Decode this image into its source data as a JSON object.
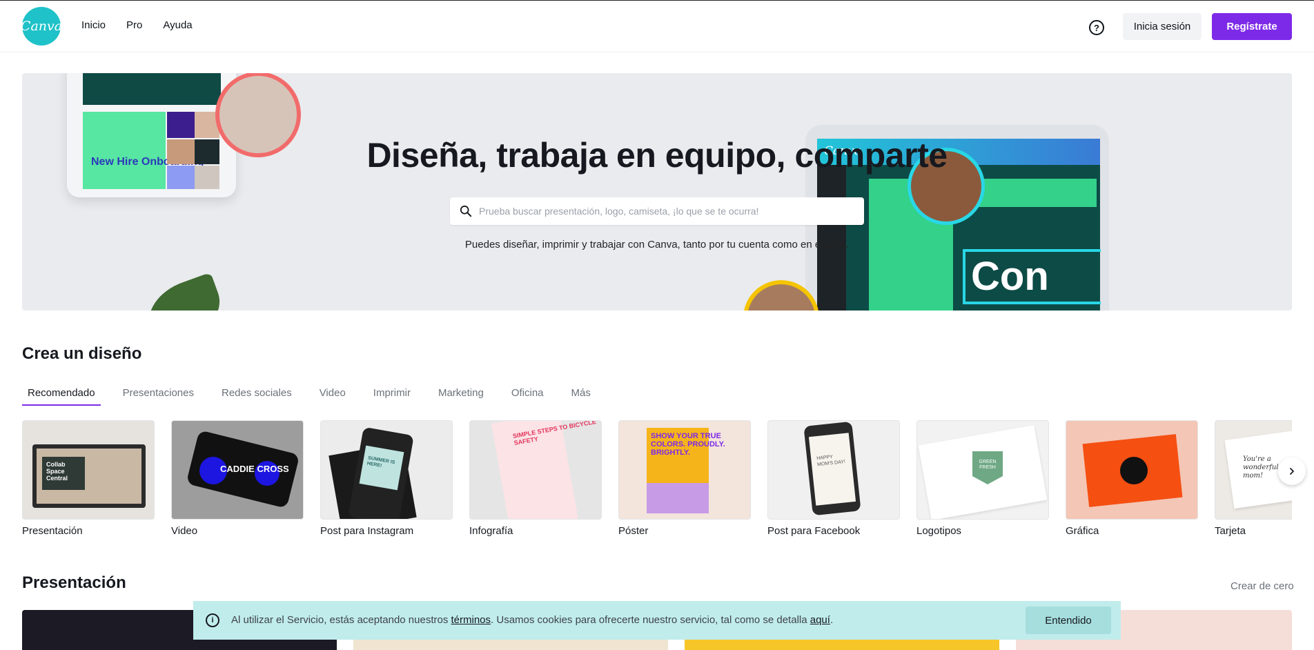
{
  "header": {
    "logo_text": "Canva",
    "nav": [
      "Inicio",
      "Pro",
      "Ayuda"
    ],
    "help_icon": "question-circle-icon",
    "login_label": "Inicia sesión",
    "register_label": "Regístrate",
    "brand_color": "#7d2ae8",
    "logo_color": "#1ec2c8"
  },
  "hero": {
    "title": "Diseña, trabaja en equipo, comparte",
    "search_placeholder": "Prueba buscar presentación, logo, camiseta, ¡lo que se te ocurra!",
    "subtitle": "Puedes diseñar, imprimir y trabajar con Canva, tanto por tu cuenta como en equipo.",
    "deco_left_text": "New Hire Onboarding",
    "deco_right_logo": "Canva",
    "deco_right_text": "Con"
  },
  "create": {
    "title": "Crea un diseño",
    "tabs": [
      "Recomendado",
      "Presentaciones",
      "Redes sociales",
      "Video",
      "Imprimir",
      "Marketing",
      "Oficina",
      "Más"
    ],
    "active_tab": "Recomendado",
    "cards": [
      {
        "label": "Presentación",
        "thumb_text": "Collab Space Central"
      },
      {
        "label": "Video",
        "thumb_text": "CADDIE CROSS"
      },
      {
        "label": "Post para Instagram",
        "thumb_text": "SUMMER IS HERE!"
      },
      {
        "label": "Infografía",
        "thumb_text": "SIMPLE STEPS TO BICYCLE SAFETY"
      },
      {
        "label": "Póster",
        "thumb_text": "SHOW YOUR TRUE COLORS. PROUDLY. BRIGHTLY."
      },
      {
        "label": "Post para Facebook",
        "thumb_text": "HAPPY MOM'S DAY!"
      },
      {
        "label": "Logotipos",
        "thumb_text": "GREEN FRESH"
      },
      {
        "label": "Gráfica",
        "thumb_text": ""
      },
      {
        "label": "Tarjeta",
        "thumb_text": "You're a wonderful mom!"
      }
    ]
  },
  "presentation": {
    "title": "Presentación",
    "link": "Crear de cero"
  },
  "cookie": {
    "text_before": "Al utilizar el Servicio, estás aceptando nuestros ",
    "terms_link": "términos",
    "text_middle": ". Usamos cookies para ofrecerte nuestro servicio, tal como se detalla ",
    "here_link": "aquí",
    "text_after": ".",
    "button": "Entendido"
  }
}
